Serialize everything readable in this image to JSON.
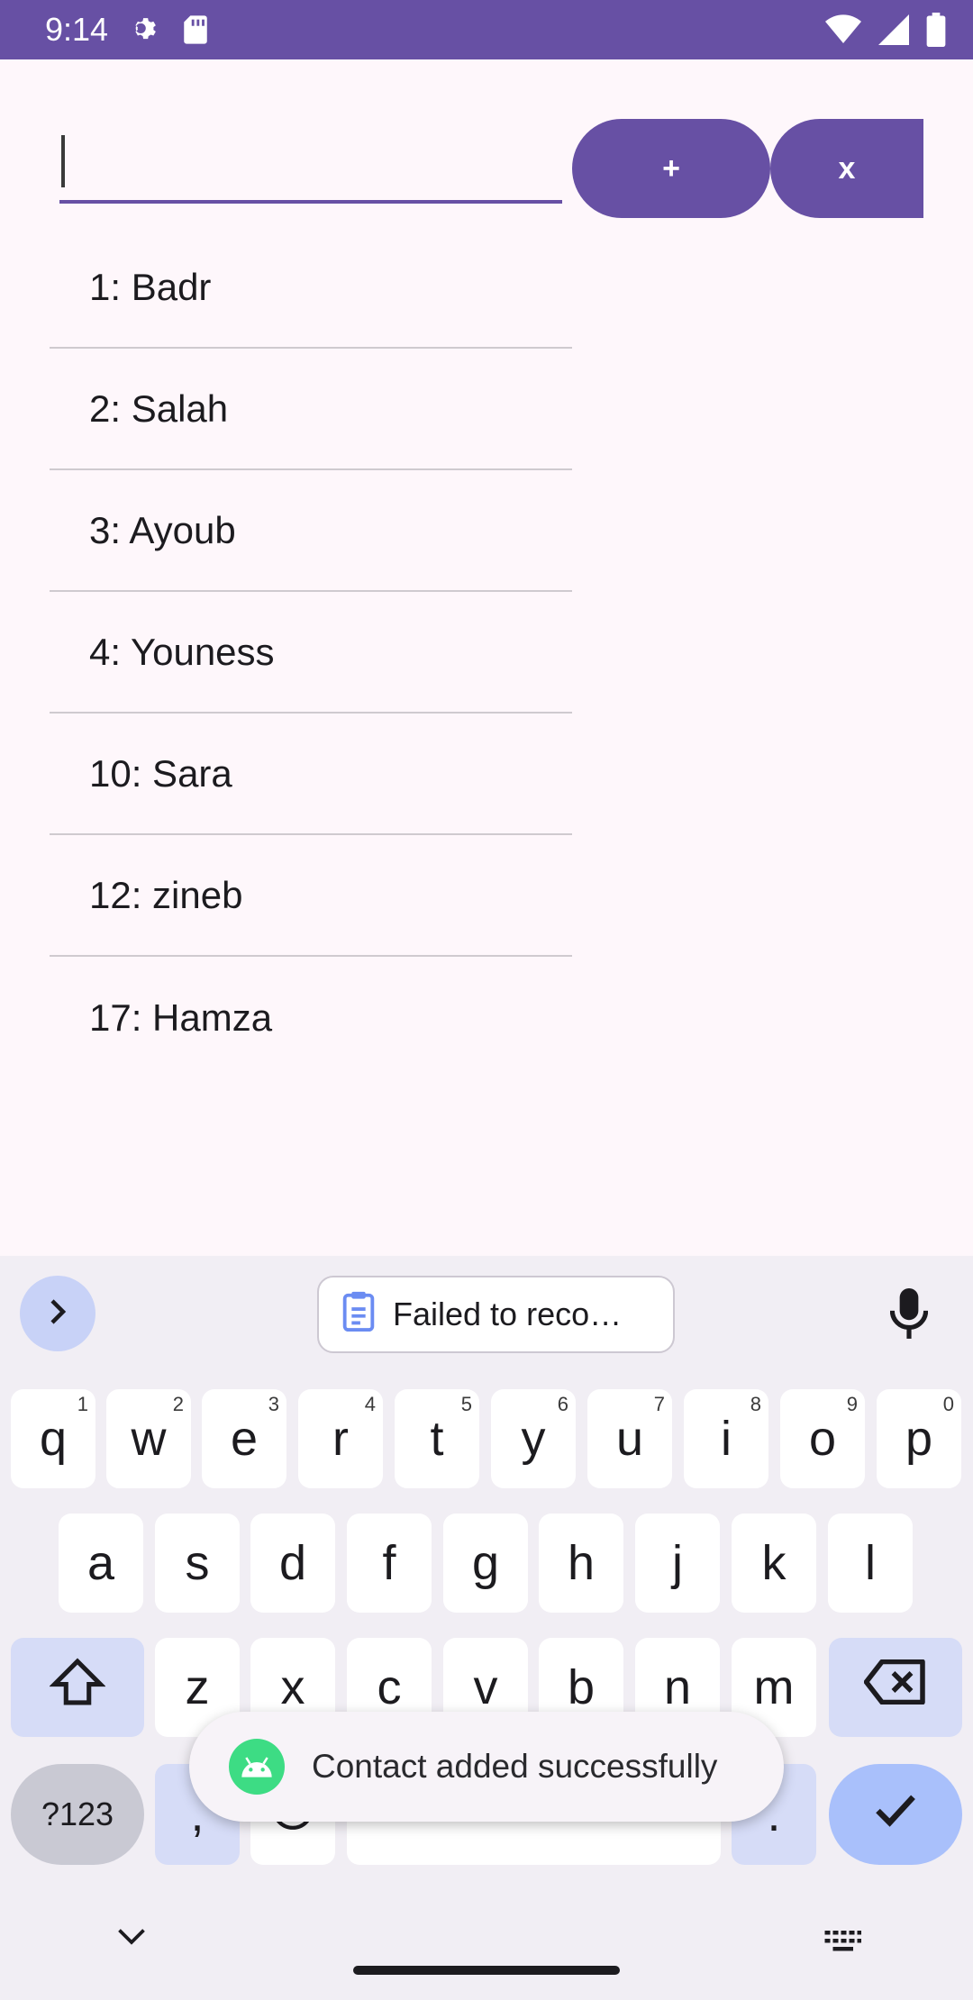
{
  "status_bar": {
    "time": "9:14",
    "left_icons": [
      "settings-icon",
      "sd-card-icon"
    ],
    "right_icons": [
      "wifi-icon",
      "signal-icon",
      "battery-icon"
    ],
    "color": "#6750a4"
  },
  "form": {
    "input_value": "",
    "add_label": "+",
    "clear_label": "x",
    "accent": "#6750a4"
  },
  "contacts": [
    "1: Badr",
    "2: Salah",
    "3: Ayoub",
    "4: Youness",
    "10: Sara",
    "12: zineb",
    "17: Hamza"
  ],
  "keyboard": {
    "clipboard_chip": "Failed to reco…",
    "row1": [
      {
        "k": "q",
        "h": "1"
      },
      {
        "k": "w",
        "h": "2"
      },
      {
        "k": "e",
        "h": "3"
      },
      {
        "k": "r",
        "h": "4"
      },
      {
        "k": "t",
        "h": "5"
      },
      {
        "k": "y",
        "h": "6"
      },
      {
        "k": "u",
        "h": "7"
      },
      {
        "k": "i",
        "h": "8"
      },
      {
        "k": "o",
        "h": "9"
      },
      {
        "k": "p",
        "h": "0"
      }
    ],
    "row2": [
      "a",
      "s",
      "d",
      "f",
      "g",
      "h",
      "j",
      "k",
      "l"
    ],
    "row3": [
      "z",
      "x",
      "c",
      "v",
      "b",
      "n",
      "m"
    ],
    "symbols_label": "?123",
    "comma_label": ",",
    "period_label": "."
  },
  "toast": {
    "message": "Contact added successfully",
    "icon": "android-icon"
  }
}
